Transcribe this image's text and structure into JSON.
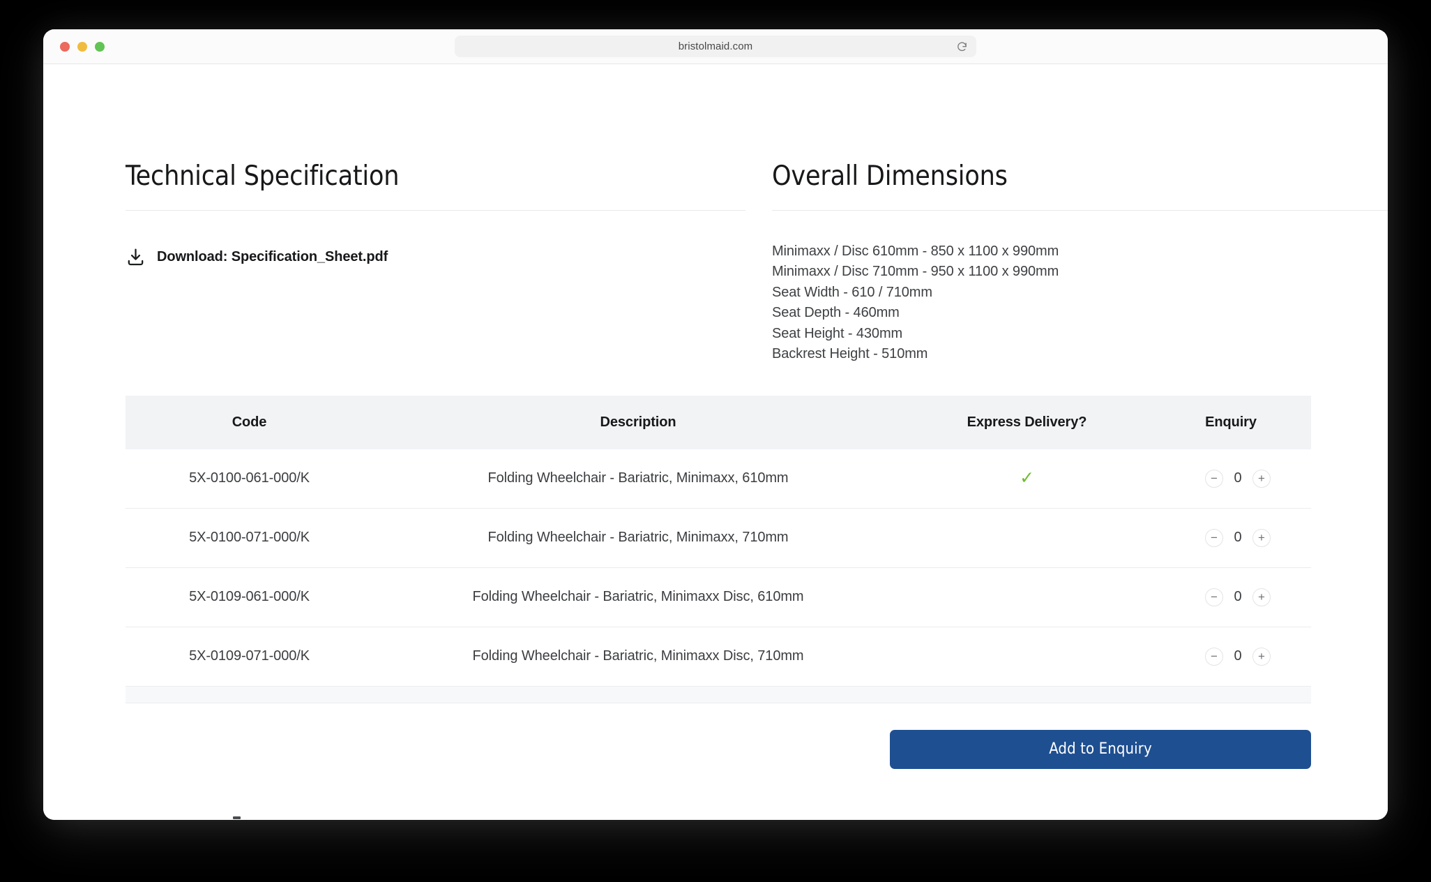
{
  "browser": {
    "url": "bristolmaid.com",
    "reload_icon": "reload-icon",
    "traffic_lights": [
      "close",
      "minimize",
      "maximize"
    ]
  },
  "technical_specification": {
    "title": "Technical Specification",
    "download": {
      "icon": "download-icon",
      "label": "Download: Specification_Sheet.pdf"
    }
  },
  "overall_dimensions": {
    "title": "Overall Dimensions",
    "lines": [
      "Minimaxx / Disc 610mm - 850 x 1100 x 990mm",
      "Minimaxx / Disc 710mm - 950 x 1100 x 990mm",
      "Seat Width - 610 / 710mm",
      "Seat Depth - 460mm",
      "Seat Height - 430mm",
      "Backrest Height - 510mm"
    ]
  },
  "products_table": {
    "columns": [
      "Code",
      "Description",
      "Express Delivery?",
      "Enquiry"
    ],
    "rows": [
      {
        "code": "5X-0100-061-000/K",
        "description": "Folding Wheelchair - Bariatric, Minimaxx, 610mm",
        "express_delivery": true,
        "quantity": "0",
        "decrement_label": "−",
        "increment_label": "+"
      },
      {
        "code": "5X-0100-071-000/K",
        "description": "Folding Wheelchair - Bariatric, Minimaxx, 710mm",
        "express_delivery": false,
        "quantity": "0",
        "decrement_label": "−",
        "increment_label": "+"
      },
      {
        "code": "5X-0109-061-000/K",
        "description": "Folding Wheelchair - Bariatric, Minimaxx Disc, 610mm",
        "express_delivery": false,
        "quantity": "0",
        "decrement_label": "−",
        "increment_label": "+"
      },
      {
        "code": "5X-0109-071-000/K",
        "description": "Folding Wheelchair - Bariatric, Minimaxx Disc, 710mm",
        "express_delivery": false,
        "quantity": "0",
        "decrement_label": "−",
        "increment_label": "+"
      }
    ],
    "express_check_glyph": "✓"
  },
  "actions": {
    "add_to_enquiry_label": "Add to Enquiry"
  },
  "colors": {
    "primary_button": "#1e4f91",
    "check_green": "#6dbe2b",
    "table_header_bg": "#f2f3f5",
    "page_bg": "#ffffff"
  }
}
